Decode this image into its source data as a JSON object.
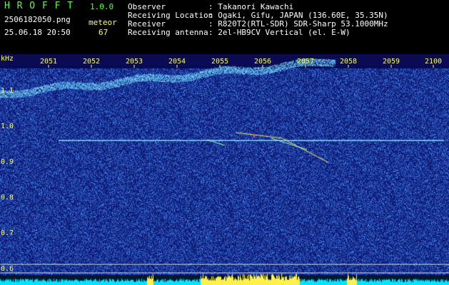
{
  "app": {
    "name": "H R O F F T",
    "version": "1.0.0"
  },
  "file": {
    "name": "2506182050.png",
    "datetime": "25.06.18 20:50"
  },
  "meteor": {
    "label": "meteor",
    "count": "67"
  },
  "info": [
    {
      "label": "Observer",
      "value": ": Takanori Kawachi"
    },
    {
      "label": "Receiving Location",
      "value": ": Ogaki, Gifu, JAPAN (136.60E, 35.35N)"
    },
    {
      "label": "Receiver",
      "value": ": R820T2(RTL-SDR) SDR-Sharp 53.1000MHz"
    },
    {
      "label": "Receiving antenna",
      "value": ": 2el-HB9CV Vertical (el. E-W)"
    }
  ],
  "axis": {
    "y_unit": "kHz",
    "y_ticks": [
      "1.1",
      "1.0",
      "0.9",
      "0.8",
      "0.7",
      "0.6"
    ],
    "x_ticks": [
      "2051",
      "2052",
      "2053",
      "2054",
      "2055",
      "2056",
      "2057",
      "2058",
      "2059",
      "2100"
    ]
  },
  "colors": {
    "background_noise": "#0a1a8a",
    "carrier": "#7fd6ff",
    "meteor_echo": "#ffe65a",
    "level_bar": "#00e5ff",
    "axis_text": "#ffff55"
  }
}
